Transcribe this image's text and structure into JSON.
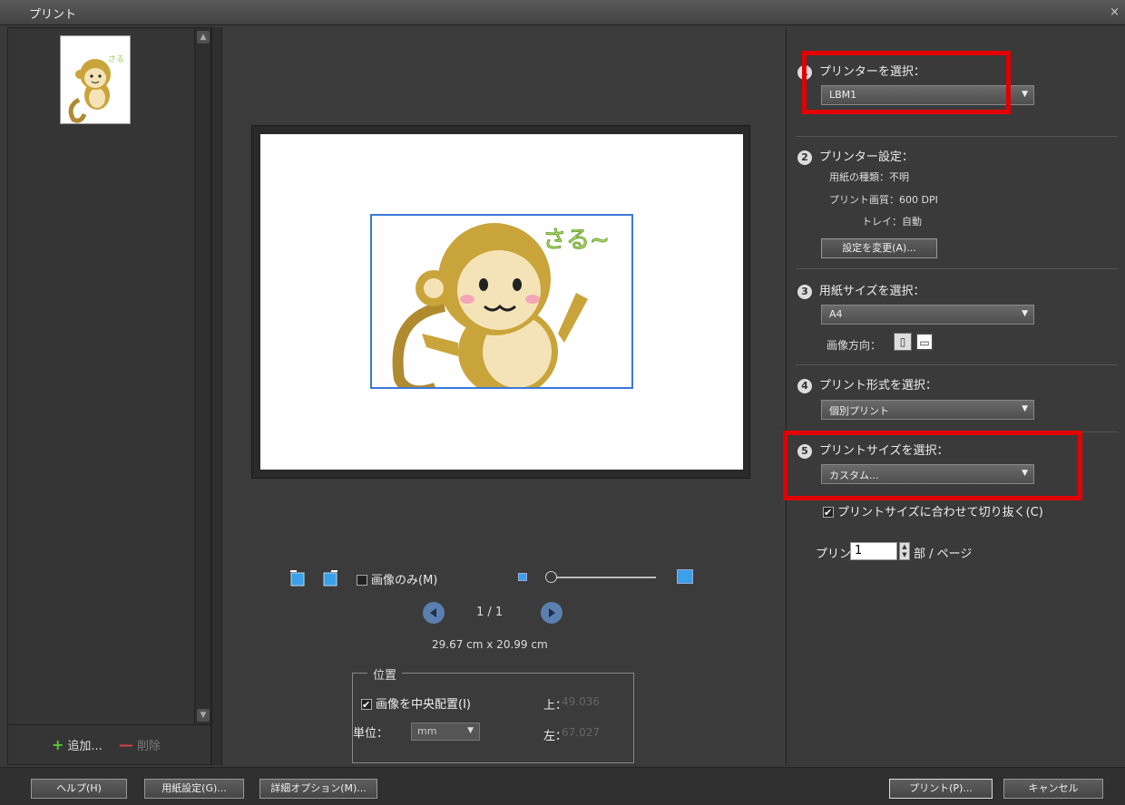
{
  "window": {
    "title": "プリント",
    "close": "×"
  },
  "left": {
    "add_label": "追加...",
    "delete_label": "削除"
  },
  "center": {
    "image_only_label": "画像のみ(M)",
    "image_only_checked": false,
    "page_indicator": "1 / 1",
    "paper_size_text": "29.67 cm x 20.99 cm",
    "position": {
      "legend": "位置",
      "center_label": "画像を中央配置(I)",
      "center_checked": true,
      "unit_label": "単位：",
      "unit_value": "mm",
      "top_label": "上：",
      "top_value": "49.036",
      "left_label": "左：",
      "left_value": "67.027"
    }
  },
  "right": {
    "step1": {
      "num": "1",
      "label": "プリンターを選択：",
      "value": "LBM1"
    },
    "step2": {
      "num": "2",
      "label": "プリンター設定：",
      "paper_type": "用紙の種類：不明",
      "print_quality": "プリント画質：600 DPI",
      "tray": "トレイ：自動",
      "change_button": "設定を変更(A)..."
    },
    "step3": {
      "num": "3",
      "label": "用紙サイズを選択：",
      "value": "A4",
      "orientation_label": "画像方向："
    },
    "step4": {
      "num": "4",
      "label": "プリント形式を選択：",
      "value": "個別プリント"
    },
    "step5": {
      "num": "5",
      "label": "プリントサイズを選択：",
      "value": "カスタム...",
      "trim_label": "プリントサイズに合わせて切り抜く(C)",
      "trim_checked": true
    },
    "copies": {
      "label": "プリント",
      "value": "1",
      "unit": "部 / ページ"
    }
  },
  "footer": {
    "help": "ヘルプ(H)",
    "page_setup": "用紙設定(G)...",
    "more_options": "詳細オプション(M)...",
    "print": "プリント(P)...",
    "cancel": "キャンセル"
  },
  "colors": {
    "highlight": "#e20000",
    "accent": "#3a78d8"
  }
}
